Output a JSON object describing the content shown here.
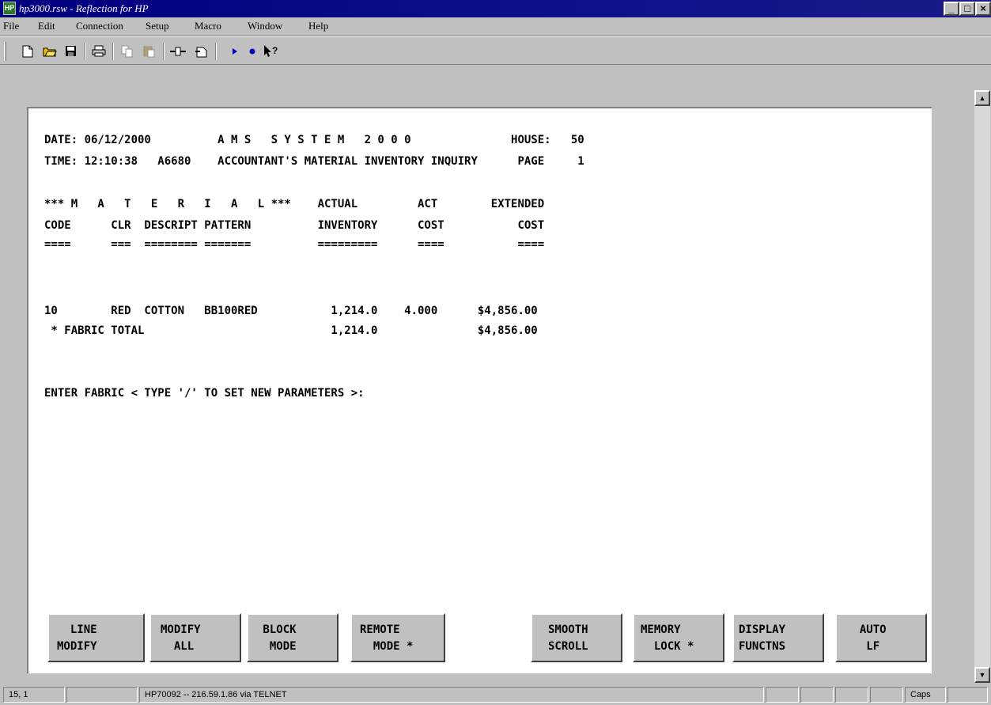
{
  "window": {
    "title": "hp3000.rsw - Reflection for HP",
    "app_icon": "HP",
    "buttons": {
      "minimize": "_",
      "maximize": "□",
      "close": "×"
    }
  },
  "menu": [
    "File",
    "Edit",
    "Connection",
    "Setup",
    "Macro",
    "Window",
    "Help"
  ],
  "toolbar": {
    "icons": [
      "new-document-icon",
      "open-folder-icon",
      "save-disk-icon",
      "print-icon",
      "copy-icon",
      "paste-icon",
      "connect-icon",
      "disconnect-icon",
      "play-macro-icon",
      "record-macro-icon",
      "context-help-icon"
    ]
  },
  "terminal": {
    "lines": [
      "DATE: 06/12/2000          A M S   S Y S T E M   2 0 0 0               HOUSE:   50",
      "TIME: 12:10:38   A6680    ACCOUNTANT'S MATERIAL INVENTORY INQUIRY      PAGE     1",
      "",
      "*** M   A   T   E   R   I   A   L ***    ACTUAL         ACT        EXTENDED",
      "CODE      CLR  DESCRIPT PATTERN          INVENTORY      COST           COST",
      "====      ===  ======== =======          =========      ====           ====",
      "",
      "",
      "",
      "10        RED  COTTON   BB100RED           1,214.0    4.000      $4,856.00",
      " * FABRIC TOTAL                            1,214.0               $4,856.00",
      "",
      "",
      "ENTER FABRIC < TYPE '/' TO SET NEW PARAMETERS >:"
    ]
  },
  "function_keys": [
    {
      "l1": "  LINE",
      "l2": "MODIFY"
    },
    {
      "l1": "MODIFY",
      "l2": "  ALL"
    },
    {
      "l1": " BLOCK",
      "l2": "  MODE"
    },
    {
      "l1": "REMOTE",
      "l2": "  MODE *"
    },
    {
      "l1": "SMOOTH",
      "l2": "SCROLL"
    },
    {
      "l1": "MEMORY",
      "l2": "  LOCK *"
    },
    {
      "l1": "DISPLAY",
      "l2": "FUNCTNS"
    },
    {
      "l1": "  AUTO",
      "l2": "   LF"
    }
  ],
  "status": {
    "cursor": "15, 1",
    "connection": "HP70092 -- 216.59.1.86 via TELNET",
    "caps": "Caps"
  }
}
